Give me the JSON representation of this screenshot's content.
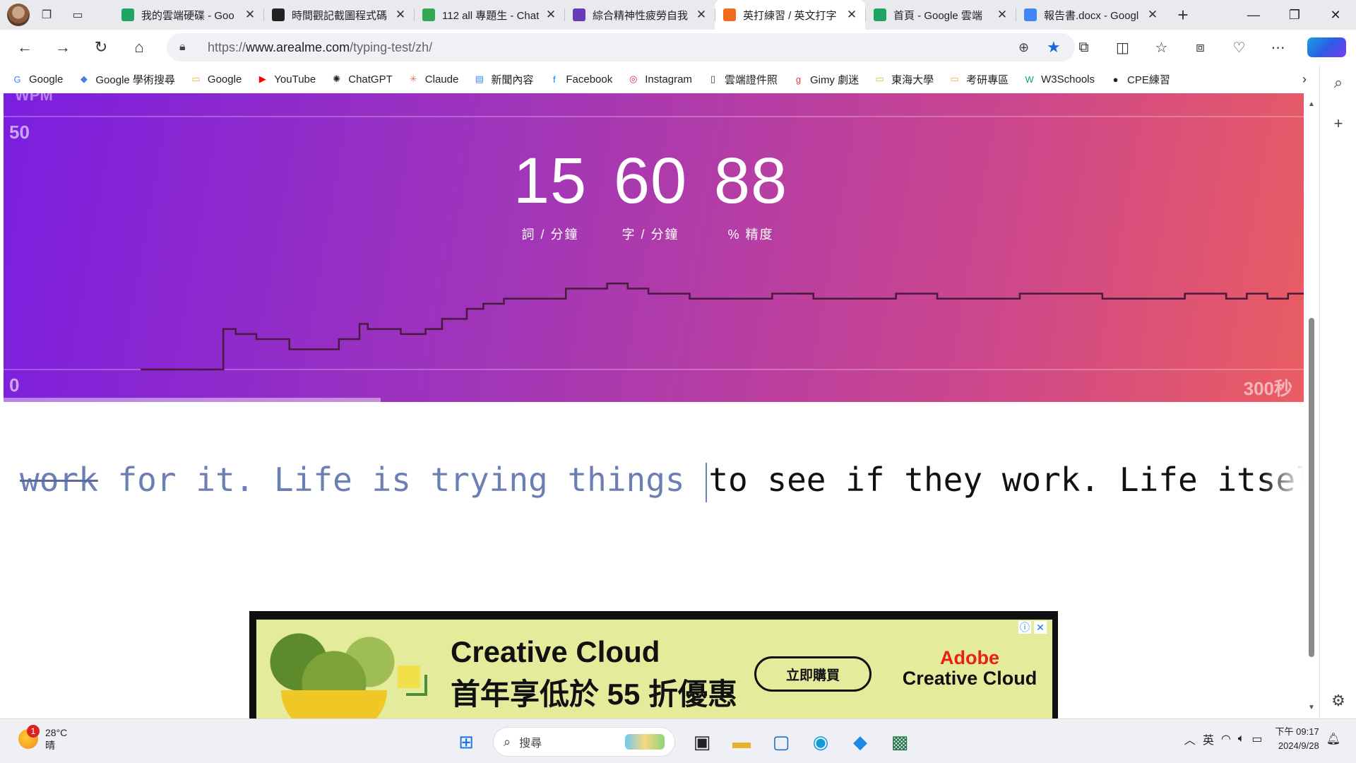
{
  "browser": {
    "tabs": [
      {
        "title": "我的雲端硬碟 - Goo",
        "icon": "google-drive-icon",
        "color": "#1fa463",
        "active": false
      },
      {
        "title": "時間觀記截圖程式碼",
        "icon": "chatgpt-icon",
        "color": "#222222",
        "active": false
      },
      {
        "title": "112 all 專題生 - Chat",
        "icon": "chat-icon",
        "color": "#34a853",
        "active": false
      },
      {
        "title": "綜合精神性疲勞自我",
        "icon": "forms-icon",
        "color": "#673ab7",
        "active": false
      },
      {
        "title": "英打練習 / 英文打字",
        "icon": "fox-icon",
        "color": "#f26b1d",
        "active": true
      },
      {
        "title": "首頁 - Google 雲端",
        "icon": "google-drive-icon",
        "color": "#1fa463",
        "active": false
      },
      {
        "title": "報告書.docx - Googl",
        "icon": "docs-icon",
        "color": "#4285f4",
        "active": false
      }
    ],
    "url_prefix": "https://",
    "url_host": "www.arealme.com",
    "url_path": "/typing-test/zh/",
    "bookmarks": [
      {
        "label": "Google",
        "icon": "google-icon"
      },
      {
        "label": "Google 學術搜尋",
        "icon": "scholar-icon"
      },
      {
        "label": "Google",
        "icon": "folder-icon"
      },
      {
        "label": "YouTube",
        "icon": "youtube-icon"
      },
      {
        "label": "ChatGPT",
        "icon": "chatgpt-icon"
      },
      {
        "label": "Claude",
        "icon": "claude-icon"
      },
      {
        "label": "新聞內容",
        "icon": "news-icon"
      },
      {
        "label": "Facebook",
        "icon": "facebook-icon"
      },
      {
        "label": "Instagram",
        "icon": "instagram-icon"
      },
      {
        "label": "雲端證件照",
        "icon": "page-icon"
      },
      {
        "label": "Gimy 劇迷",
        "icon": "gimy-icon"
      },
      {
        "label": "東海大學",
        "icon": "folder-icon"
      },
      {
        "label": "考研專區",
        "icon": "folder-icon"
      },
      {
        "label": "W3Schools",
        "icon": "w3schools-icon"
      },
      {
        "label": "CPE練習",
        "icon": "github-icon"
      }
    ]
  },
  "typing_test": {
    "axis_label": "WPM",
    "stats": [
      {
        "value": "15",
        "label": "詞 / 分鐘"
      },
      {
        "value": "60",
        "label": "字 / 分鐘"
      },
      {
        "value": "88",
        "label": "% 精度"
      }
    ],
    "progress_fraction": 0.29,
    "typed_wrong": "work",
    "typed_text": " for it. Life is trying things ",
    "pending_text": "to see if they work. Life itself is t"
  },
  "chart_data": {
    "type": "line",
    "title": "",
    "ylabel": "WPM",
    "xlabel": "",
    "ylim": [
      0,
      50
    ],
    "y_ticks": [
      "50",
      "0"
    ],
    "x_end_label": "300秒",
    "x_seconds": [
      17,
      33,
      37,
      40,
      45,
      53,
      55,
      65,
      70,
      72,
      80,
      86,
      90,
      96,
      100,
      105,
      110,
      120,
      130,
      135,
      140,
      150,
      160,
      170,
      180,
      200,
      210,
      230,
      240,
      250,
      260,
      270,
      280,
      285,
      290,
      295,
      300
    ],
    "values": [
      0,
      0,
      8,
      7,
      6,
      4,
      4,
      6,
      9,
      8,
      7,
      8,
      10,
      12,
      13,
      14,
      14,
      16,
      17,
      16,
      15,
      14,
      14,
      15,
      14,
      15,
      14,
      15,
      15,
      14,
      14,
      15,
      14,
      15,
      14,
      15,
      15
    ],
    "series": [
      {
        "values": "values"
      }
    ],
    "line_color": "#4a1a3e",
    "grid": true
  },
  "ad": {
    "title": "Creative Cloud",
    "subtitle": "首年享低於 55 折優惠",
    "button": "立即購買",
    "brand_top": "Adobe",
    "brand_bottom": "Creative Cloud"
  },
  "taskbar": {
    "temperature": "28°C",
    "weather_text": "晴",
    "badge": "1",
    "search_placeholder": "搜尋",
    "ime": "英",
    "time": "下午 09:17",
    "date": "2024/9/28"
  }
}
